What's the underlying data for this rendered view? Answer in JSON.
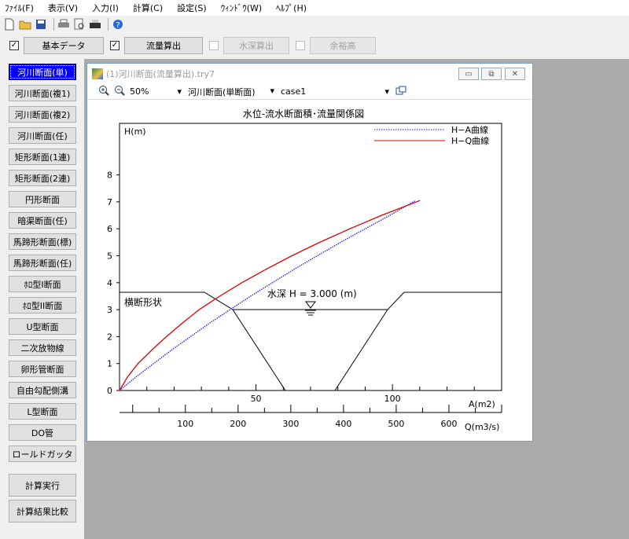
{
  "menubar": {
    "items": [
      "ﾌｧｲﾙ(F)",
      "表示(V)",
      "入力(I)",
      "計算(C)",
      "設定(S)",
      "ｳｨﾝﾄﾞｳ(W)",
      "ﾍﾙﾌﾟ(H)"
    ]
  },
  "toolbar": {
    "icons": [
      "new-file-icon",
      "open-folder-icon",
      "save-icon",
      "print-icon",
      "print-preview-icon",
      "printer-setup-icon",
      "help-icon"
    ]
  },
  "modes": [
    {
      "label": "基本データ",
      "checked": true,
      "enabled": true
    },
    {
      "label": "流量算出",
      "checked": true,
      "enabled": true
    },
    {
      "label": "水深算出",
      "checked": false,
      "enabled": false
    },
    {
      "label": "余裕高",
      "checked": false,
      "enabled": false
    }
  ],
  "sidebar": {
    "items": [
      "河川断面(単)",
      "河川断面(複1)",
      "河川断面(複2)",
      "河川断面(任)",
      "矩形断面(1連)",
      "矩形断面(2連)",
      "円形断面",
      "暗渠断面(任)",
      "馬蹄形断面(標)",
      "馬蹄形断面(任)",
      "ﾎﾛ型I断面",
      "ﾎﾛ型II断面",
      "U型断面",
      "二次放物線",
      "卵形管断面",
      "自由勾配側溝",
      "L型断面",
      "DO管",
      "ロールドガッタ"
    ],
    "active_index": 0,
    "actions": [
      "計算実行",
      "計算結果比較"
    ]
  },
  "window": {
    "title": "(1)河川断面(流量算出).try7",
    "zoom": "50%",
    "section_type": "河川断面(単断面)",
    "case": "case1",
    "buttons": {
      "minimize": "▭",
      "restore": "⧉",
      "close": "✕"
    }
  },
  "chart_data": {
    "type": "line",
    "title": "水位-流水断面積･流量関係図",
    "ylabel": "H(m)",
    "xlabel_area": "A(m2)",
    "xlabel_flow": "Q(m3/s)",
    "ylim": [
      0,
      8
    ],
    "y_ticks": [
      "0",
      "1",
      "2",
      "3",
      "4",
      "5",
      "6",
      "7",
      "8"
    ],
    "area_axis": {
      "range": [
        0,
        140
      ],
      "tick_labels": [
        "50",
        "100"
      ]
    },
    "flow_axis": {
      "range": [
        -25,
        700
      ],
      "tick_labels": [
        "100",
        "200",
        "300",
        "400",
        "500",
        "600"
      ]
    },
    "series": [
      {
        "name": "H−A曲線",
        "color": "#1a1aff",
        "style": "dotted",
        "axis": "area",
        "points": [
          [
            0,
            0
          ],
          [
            6,
            0.5
          ],
          [
            12.5,
            1.0
          ],
          [
            19,
            1.5
          ],
          [
            26,
            2.0
          ],
          [
            33,
            2.5
          ],
          [
            40.5,
            3.0
          ],
          [
            48,
            3.5
          ],
          [
            56,
            4.0
          ],
          [
            64,
            4.5
          ],
          [
            72.5,
            5.0
          ],
          [
            81,
            5.5
          ],
          [
            90,
            6.0
          ],
          [
            99,
            6.5
          ],
          [
            108.5,
            7.05
          ]
        ]
      },
      {
        "name": "H−Q曲線",
        "color": "#e00000",
        "style": "solid",
        "axis": "flow",
        "points": [
          [
            -25,
            0
          ],
          [
            -10,
            0.5
          ],
          [
            10,
            1.0
          ],
          [
            36,
            1.5
          ],
          [
            64,
            2.0
          ],
          [
            94,
            2.5
          ],
          [
            126,
            3.0
          ],
          [
            165,
            3.5
          ],
          [
            207,
            4.0
          ],
          [
            253,
            4.5
          ],
          [
            302,
            5.0
          ],
          [
            355,
            5.5
          ],
          [
            412,
            6.0
          ],
          [
            472,
            6.5
          ],
          [
            545,
            7.05
          ]
        ]
      }
    ],
    "cross_section": {
      "label": "横断形状",
      "water_label": "水深 H = 3.000 (m)"
    }
  }
}
